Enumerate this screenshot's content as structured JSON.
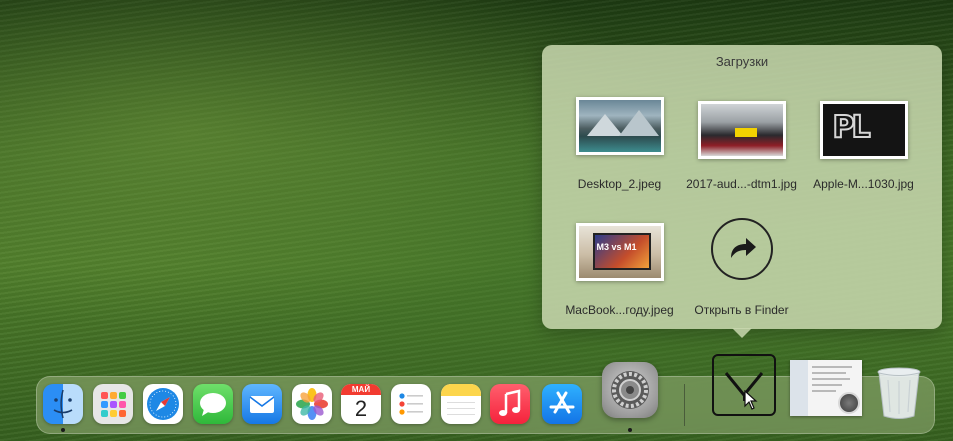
{
  "stack_popover": {
    "title": "Загрузки",
    "items": [
      {
        "label": "Desktop_2.jpeg",
        "kind": "image-thumbnail"
      },
      {
        "label": "2017-aud...-dtm1.jpg",
        "kind": "image-thumbnail"
      },
      {
        "label": "Apple-M...1030.jpg",
        "kind": "image-thumbnail"
      },
      {
        "label": "MacBook...году.jpeg",
        "kind": "image-thumbnail"
      }
    ],
    "open_in_finder": "Открыть в Finder"
  },
  "dock": {
    "apps": [
      {
        "name": "Finder",
        "icon": "finder-icon",
        "running": true
      },
      {
        "name": "Launchpad",
        "icon": "launchpad-icon",
        "running": false
      },
      {
        "name": "Safari",
        "icon": "safari-icon",
        "running": false
      },
      {
        "name": "Messages",
        "icon": "messages-icon",
        "running": false
      },
      {
        "name": "Mail",
        "icon": "mail-icon",
        "running": false
      },
      {
        "name": "Photos",
        "icon": "photos-icon",
        "running": false
      },
      {
        "name": "Calendar",
        "icon": "calendar-icon",
        "running": false
      },
      {
        "name": "Reminders",
        "icon": "reminders-icon",
        "running": false
      },
      {
        "name": "Notes",
        "icon": "notes-icon",
        "running": false
      },
      {
        "name": "Music",
        "icon": "music-icon",
        "running": false
      },
      {
        "name": "App Store",
        "icon": "app-store-icon",
        "running": false
      },
      {
        "name": "System Settings",
        "icon": "settings-icon",
        "running": true
      }
    ],
    "calendar": {
      "month": "МАЙ",
      "day": "2"
    },
    "stacks": [
      "downloads-stack-icon",
      "screenshot-thumbnail",
      "trash-icon"
    ]
  },
  "colors": {
    "popover_bg": "#c8d7af",
    "dock_bg": "#aabe8c",
    "wallpaper": "#4d7c2a"
  }
}
